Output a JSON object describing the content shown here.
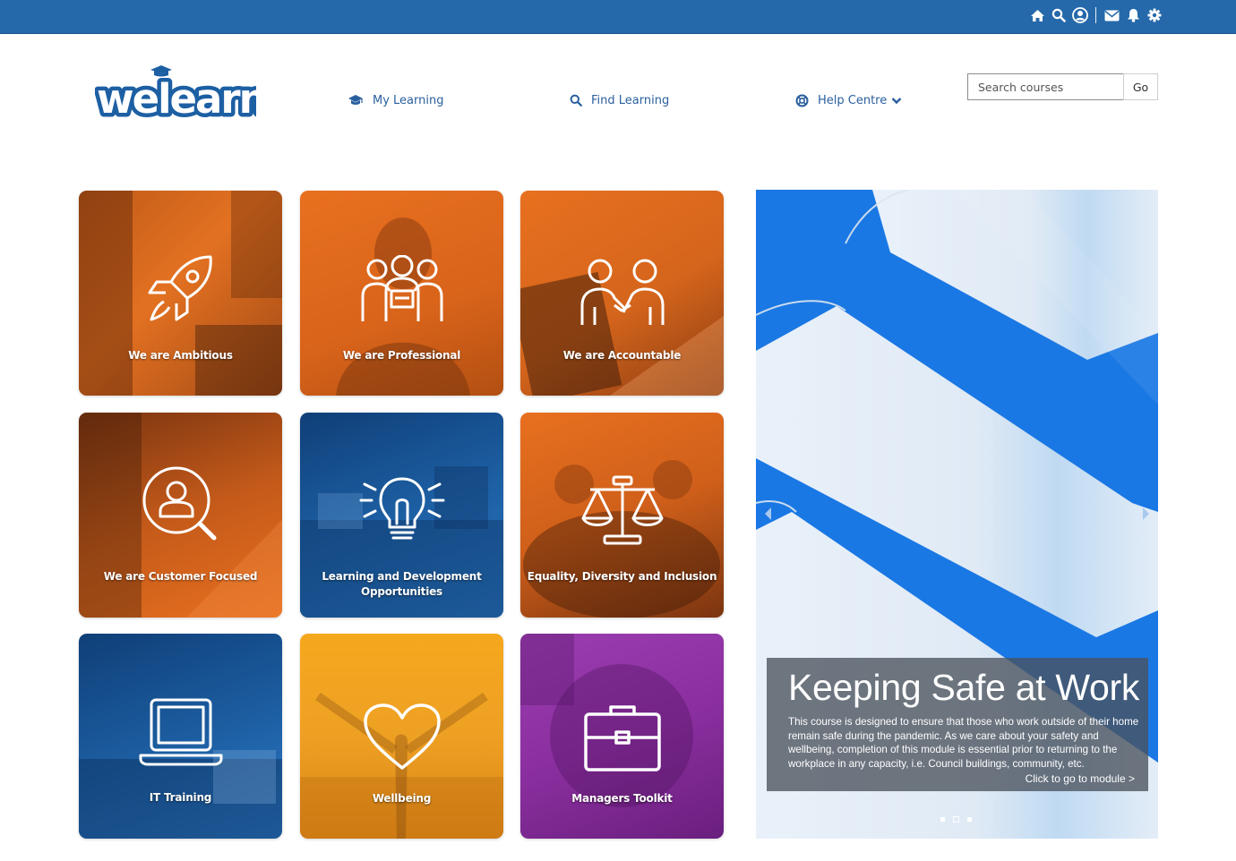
{
  "topbar": {
    "icons": [
      "home-icon",
      "search-icon",
      "user-icon",
      "mail-icon",
      "bell-icon",
      "gear-icon"
    ],
    "color": "#2569ab"
  },
  "logo": {
    "text": "welearn"
  },
  "nav": {
    "my_learning": "My Learning",
    "find_learning": "Find Learning",
    "help_centre": "Help Centre"
  },
  "search": {
    "placeholder": "Search courses",
    "button": "Go"
  },
  "tiles": [
    {
      "label": "We are Ambitious",
      "icon": "rocket-icon",
      "color": "#e8701f"
    },
    {
      "label": "We are Professional",
      "icon": "team-icon",
      "color": "#e8701f"
    },
    {
      "label": "We are Accountable",
      "icon": "handshake-icon",
      "color": "#e8701f"
    },
    {
      "label": "We are Customer Focused",
      "icon": "user-search-icon",
      "color": "#e8701f"
    },
    {
      "label": "Learning and Development Opportunities",
      "icon": "lightbulb-icon",
      "color": "#1d5fa3"
    },
    {
      "label": "Equality, Diversity and Inclusion",
      "icon": "scales-icon",
      "color": "#e8701f"
    },
    {
      "label": "IT Training",
      "icon": "laptop-icon",
      "color": "#1d5fa3"
    },
    {
      "label": "Wellbeing",
      "icon": "heart-icon",
      "color": "#f2a020"
    },
    {
      "label": "Managers Toolkit",
      "icon": "toolbox-icon",
      "color": "#8b2fa0"
    }
  ],
  "slider": {
    "title": "Keeping Safe at Work",
    "description": "This course is designed to ensure that those who work outside of their home remain safe during the pandemic. As we care about your safety and wellbeing, completion of this module is essential prior to returning to the workplace in any capacity, i.e. Council buildings, community, etc.",
    "link": "Click to go to module >",
    "slide_count": 3,
    "active_slide": 2
  }
}
